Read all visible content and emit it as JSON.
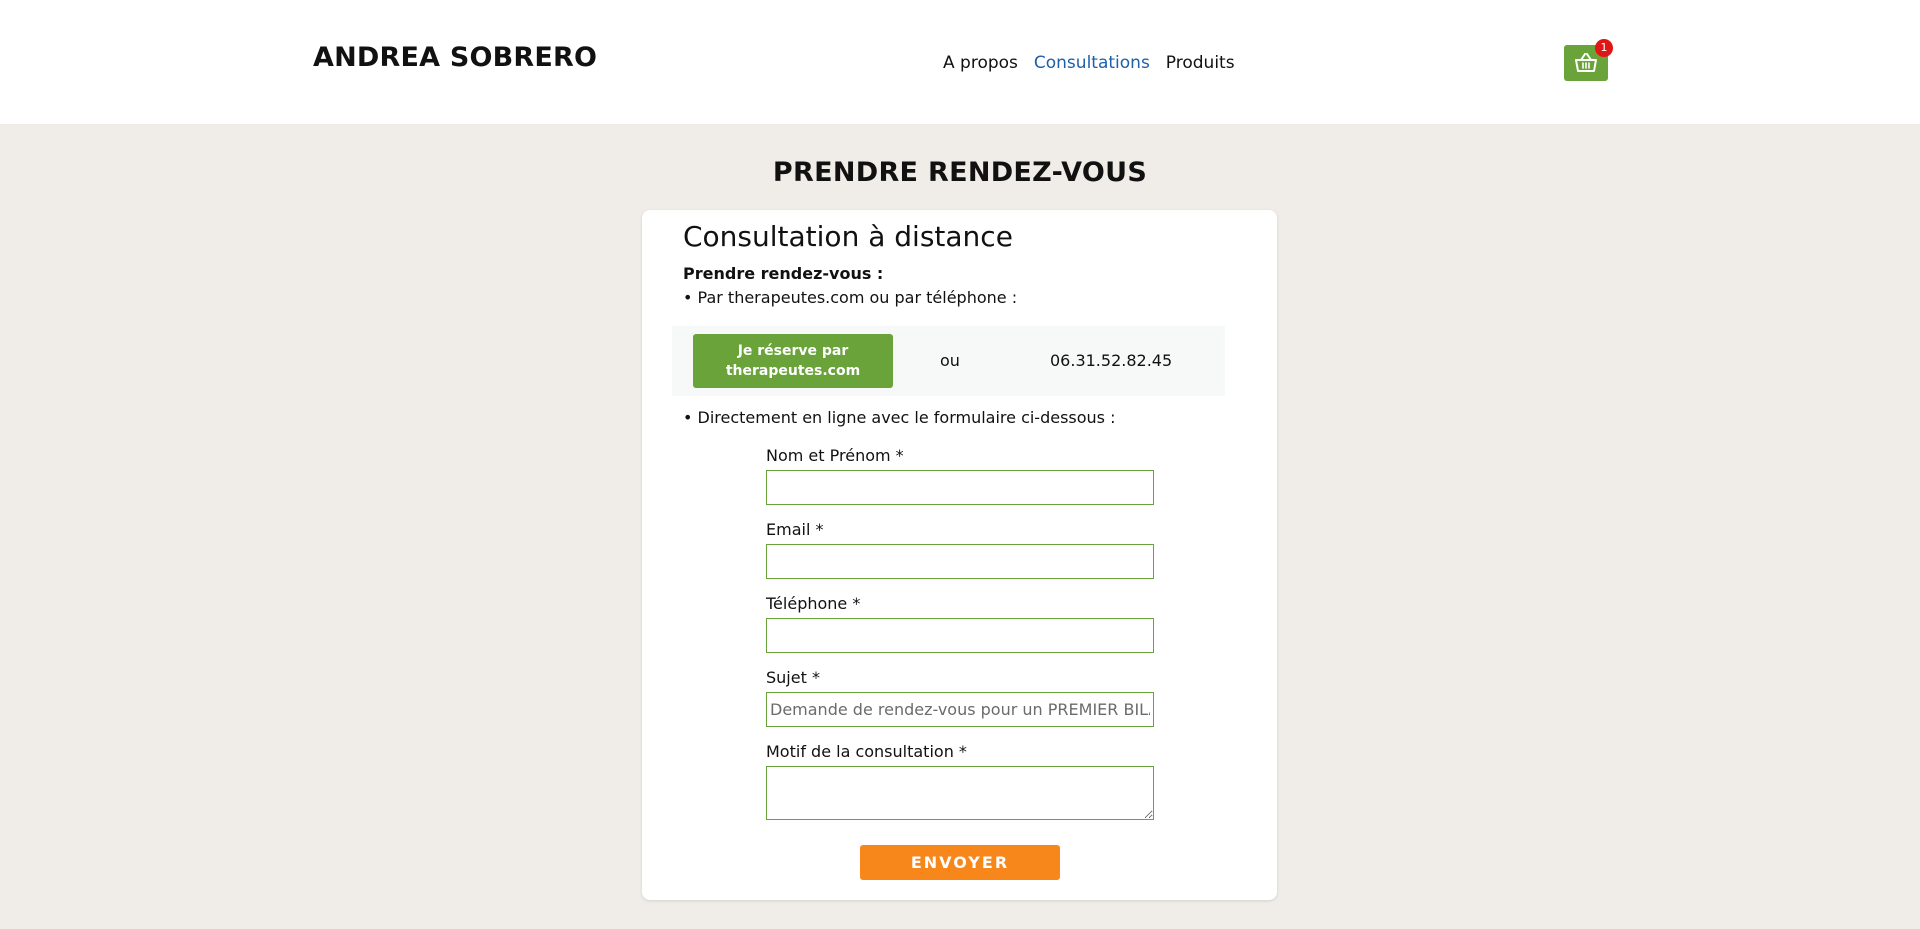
{
  "header": {
    "logo": "ANDREA SOBRERO",
    "nav": [
      {
        "label": "A propos",
        "active": false
      },
      {
        "label": "Consultations",
        "active": true
      },
      {
        "label": "Produits",
        "active": false
      }
    ],
    "cart": {
      "icon": "basket-icon",
      "count": "1"
    }
  },
  "page_title": "PRENDRE RENDEZ-VOUS",
  "card": {
    "title": "Consultation à distance",
    "rdv_label": "Prendre rendez-vous :",
    "bullet_phone": "• Par therapeutes.com ou par téléphone :",
    "booking_button": "Je réserve par therapeutes.com",
    "or_text": "ou",
    "phone_number": "06.31.52.82.45",
    "bullet_form": "• Directement en ligne avec le formulaire ci-dessous :"
  },
  "form": {
    "name_label": "Nom et Prénom *",
    "name_value": "",
    "email_label": "Email *",
    "email_value": "",
    "phone_label": "Téléphone *",
    "phone_value": "",
    "subject_label": "Sujet *",
    "subject_placeholder": "Demande de rendez-vous pour un PREMIER BILAN",
    "reason_label": "Motif de la consultation *",
    "reason_value": "",
    "submit_label": "ENVOYER"
  },
  "colors": {
    "accent_green": "#6aa33a",
    "accent_orange": "#f7861b",
    "nav_active": "#1f5fa8",
    "badge_red": "#e01515",
    "page_bg": "#f0ede8"
  }
}
